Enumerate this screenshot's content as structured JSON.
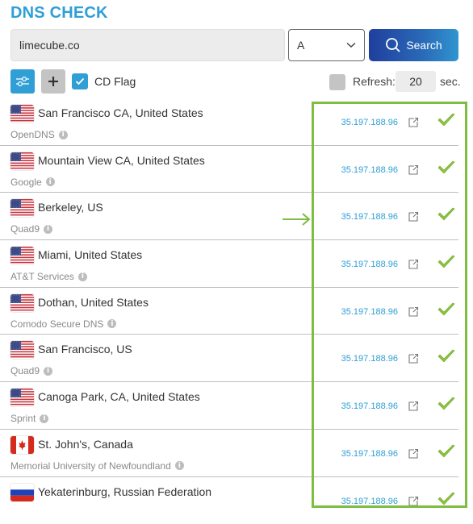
{
  "header": {
    "title": "DNS CHECK"
  },
  "search": {
    "domain_value": "limecube.co",
    "record_type": "A",
    "button_label": "Search"
  },
  "options": {
    "cd_flag_label": "CD Flag",
    "cd_flag_checked": true,
    "refresh_checked": false,
    "refresh_label": "Refresh:",
    "refresh_value": "20",
    "refresh_unit": "sec."
  },
  "colors": {
    "accent": "#2f9fd6",
    "highlight": "#7dbd42",
    "success": "#8cc43f"
  },
  "results": [
    {
      "flag": "us",
      "location": "San Francisco CA, United States",
      "provider": "OpenDNS",
      "ip": "35.197.188.96",
      "status": "ok"
    },
    {
      "flag": "us",
      "location": "Mountain View CA, United States",
      "provider": "Google",
      "ip": "35.197.188.96",
      "status": "ok"
    },
    {
      "flag": "us",
      "location": "Berkeley, US",
      "provider": "Quad9",
      "ip": "35.197.188.96",
      "status": "ok"
    },
    {
      "flag": "us",
      "location": "Miami, United States",
      "provider": "AT&T Services",
      "ip": "35.197.188.96",
      "status": "ok"
    },
    {
      "flag": "us",
      "location": "Dothan, United States",
      "provider": "Comodo Secure DNS",
      "ip": "35.197.188.96",
      "status": "ok"
    },
    {
      "flag": "us",
      "location": "San Francisco, US",
      "provider": "Quad9",
      "ip": "35.197.188.96",
      "status": "ok"
    },
    {
      "flag": "us",
      "location": "Canoga Park, CA, United States",
      "provider": "Sprint",
      "ip": "35.197.188.96",
      "status": "ok"
    },
    {
      "flag": "ca",
      "location": "St. John's, Canada",
      "provider": "Memorial University of Newfoundland",
      "ip": "35.197.188.96",
      "status": "ok"
    },
    {
      "flag": "ru",
      "location": "Yekaterinburg, Russian Federation",
      "provider": "",
      "ip": "35.197.188.96",
      "status": "ok"
    }
  ]
}
